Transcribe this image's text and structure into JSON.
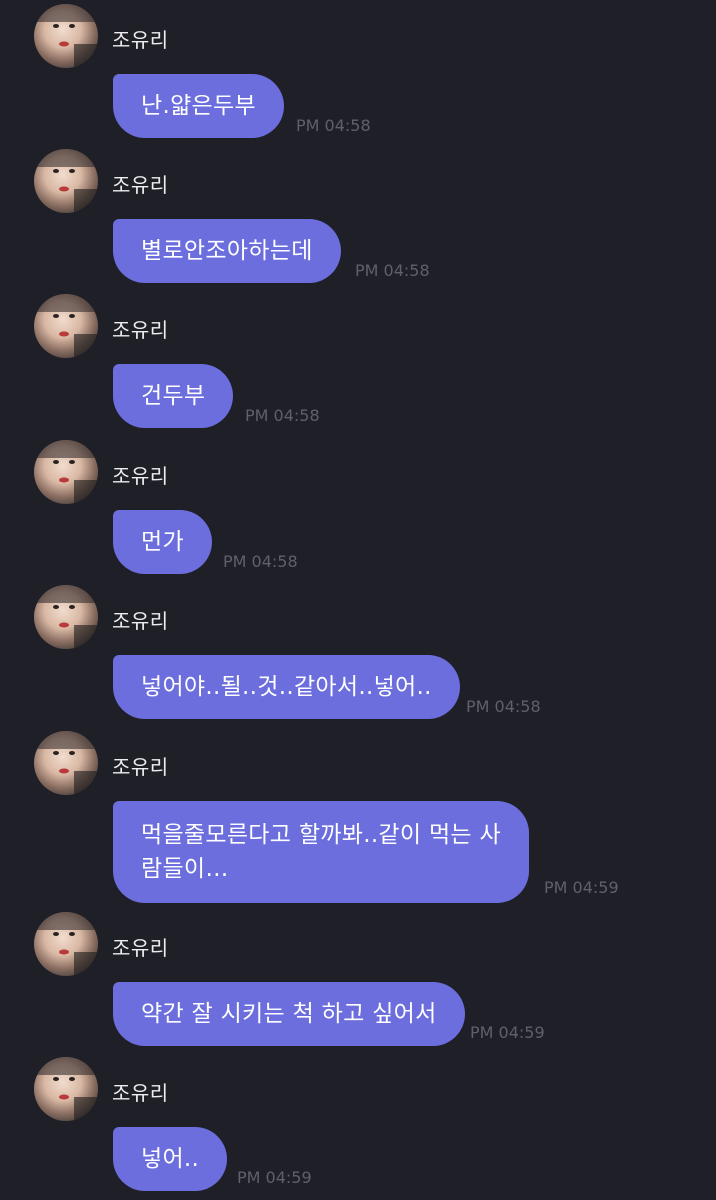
{
  "messages": [
    {
      "sender": "조유리",
      "text": "난.얇은두부",
      "time": "PM 04:58"
    },
    {
      "sender": "조유리",
      "text": "별로안조아하는데",
      "time": "PM 04:58"
    },
    {
      "sender": "조유리",
      "text": "건두부",
      "time": "PM 04:58"
    },
    {
      "sender": "조유리",
      "text": "먼가",
      "time": "PM 04:58"
    },
    {
      "sender": "조유리",
      "text": "넣어야..될..것..같아서..넣어..",
      "time": "PM 04:58"
    },
    {
      "sender": "조유리",
      "text": "먹을줄모른다고 할까봐..같이 먹는 사람들이…",
      "time": "PM 04:59"
    },
    {
      "sender": "조유리",
      "text": "약간 잘 시키는 척 하고 싶어서",
      "time": "PM 04:59"
    },
    {
      "sender": "조유리",
      "text": "넣어..",
      "time": "PM 04:59"
    }
  ],
  "colors": {
    "background": "#1f1f27",
    "bubble": "#6b6edc",
    "sender_text": "#ececf1",
    "timestamp": "#5f606b"
  }
}
